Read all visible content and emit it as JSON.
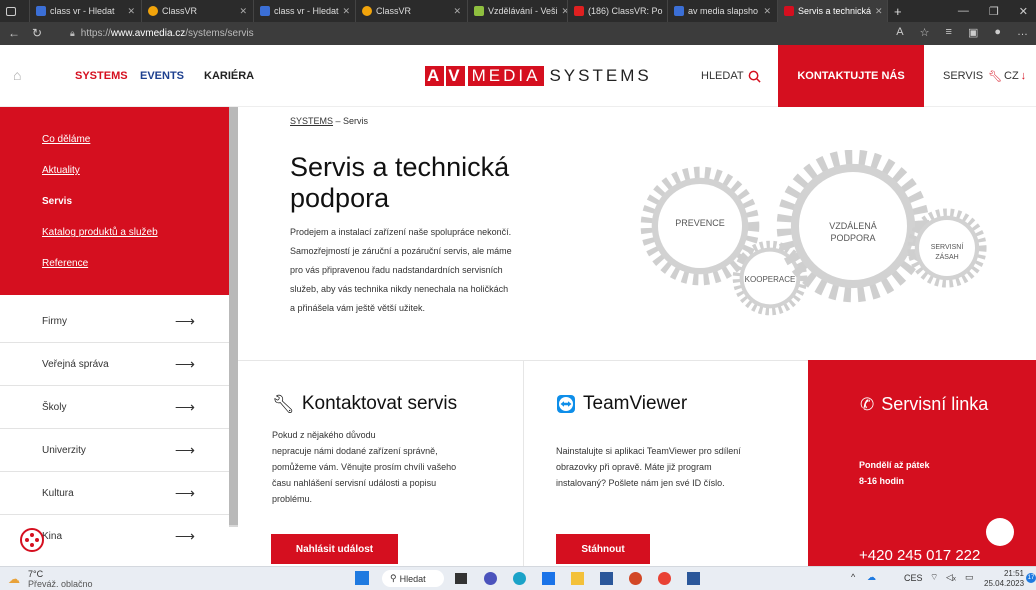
{
  "browser": {
    "tabs": [
      {
        "label": "",
        "icon": "window-icon"
      },
      {
        "label": "class vr - Hledat",
        "icon": "search-icon"
      },
      {
        "label": "ClassVR",
        "icon": "classvr-icon"
      },
      {
        "label": "class vr - Hledat",
        "icon": "search-icon"
      },
      {
        "label": "ClassVR",
        "icon": "classvr-icon"
      },
      {
        "label": "Vzdělávání - Veši",
        "icon": "doc-icon"
      },
      {
        "label": "(186) ClassVR: Po",
        "icon": "youtube-icon"
      },
      {
        "label": "av media slapsho",
        "icon": "search-icon"
      },
      {
        "label": "Servis a technická",
        "icon": "avmedia-icon"
      }
    ],
    "url_prefix": "https://",
    "url_host": "www.avmedia.cz",
    "url_path": "/systems/servis"
  },
  "header": {
    "nav": [
      "SYSTEMS",
      "EVENTS",
      "KARIÉRA"
    ],
    "logo_box1": "A",
    "logo_box2": "V",
    "logo_media": "MEDIA",
    "logo_systems": "SYSTEMS",
    "search_label": "HLEDAT",
    "contact_label": "KONTAKTUJTE NÁS",
    "servis_label": "SERVIS",
    "lang_label": "CZ"
  },
  "sidebar": {
    "red_links": [
      "Co děláme",
      "Aktuality",
      "Servis",
      "Katalog produktů a služeb",
      "Reference"
    ],
    "items": [
      "Firmy",
      "Veřejná správa",
      "Školy",
      "Univerzity",
      "Kultura",
      "Kina"
    ]
  },
  "main": {
    "breadcrumb_link": "SYSTEMS",
    "breadcrumb_sep": " – ",
    "breadcrumb_current": "Servis",
    "title_line1": "Servis a technická",
    "title_line2": "podpora",
    "intro_lines": [
      "Prodejem a instalací zařízení naše spolupráce nekončí.",
      "Samozřejmostí je záruční a pozáruční servis, ale máme",
      "pro vás připravenou řadu nadstandardních servisních",
      "služeb, aby vás technika nikdy nenechala na holičkách",
      "a přinášela vám ještě větší užitek."
    ],
    "gears": {
      "prevence": "PREVENCE",
      "kooperace": "KOOPERACE",
      "vzdalena_1": "VZDÁLENÁ",
      "vzdalena_2": "PODPORA",
      "servisni_1": "SERVISNÍ",
      "servisni_2": "ZÁSAH"
    }
  },
  "cards": {
    "kontakt": {
      "title": "Kontaktovat servis",
      "lines": [
        "Pokud z nějakého důvodu",
        "nepracuje námi dodané zařízení správně,",
        "pomůžeme vám. Věnujte prosím chvíli vašeho",
        "času nahlášení servisní události a popisu",
        "problému."
      ],
      "button": "Nahlásit událost"
    },
    "teamviewer": {
      "title": "TeamViewer",
      "lines": [
        "Nainstalujte si aplikaci TeamViewer pro sdílení",
        "obrazovky při opravě. Máte již program",
        "instalovaný? Pošlete nám jen své ID číslo."
      ],
      "button": "Stáhnout"
    },
    "linka": {
      "title": "Servisní linka",
      "days": "Pondělí až pátek",
      "hours": "8-16 hodin",
      "phone": "+420 245 017 222"
    }
  },
  "taskbar": {
    "temp": "7°C",
    "weather": "Převáž. oblačno",
    "search": "Hledat",
    "lang": "CES",
    "time": "21:51",
    "date": "25.04.2023",
    "badge": "17"
  },
  "colors": {
    "brand_red": "#d50f1f"
  }
}
